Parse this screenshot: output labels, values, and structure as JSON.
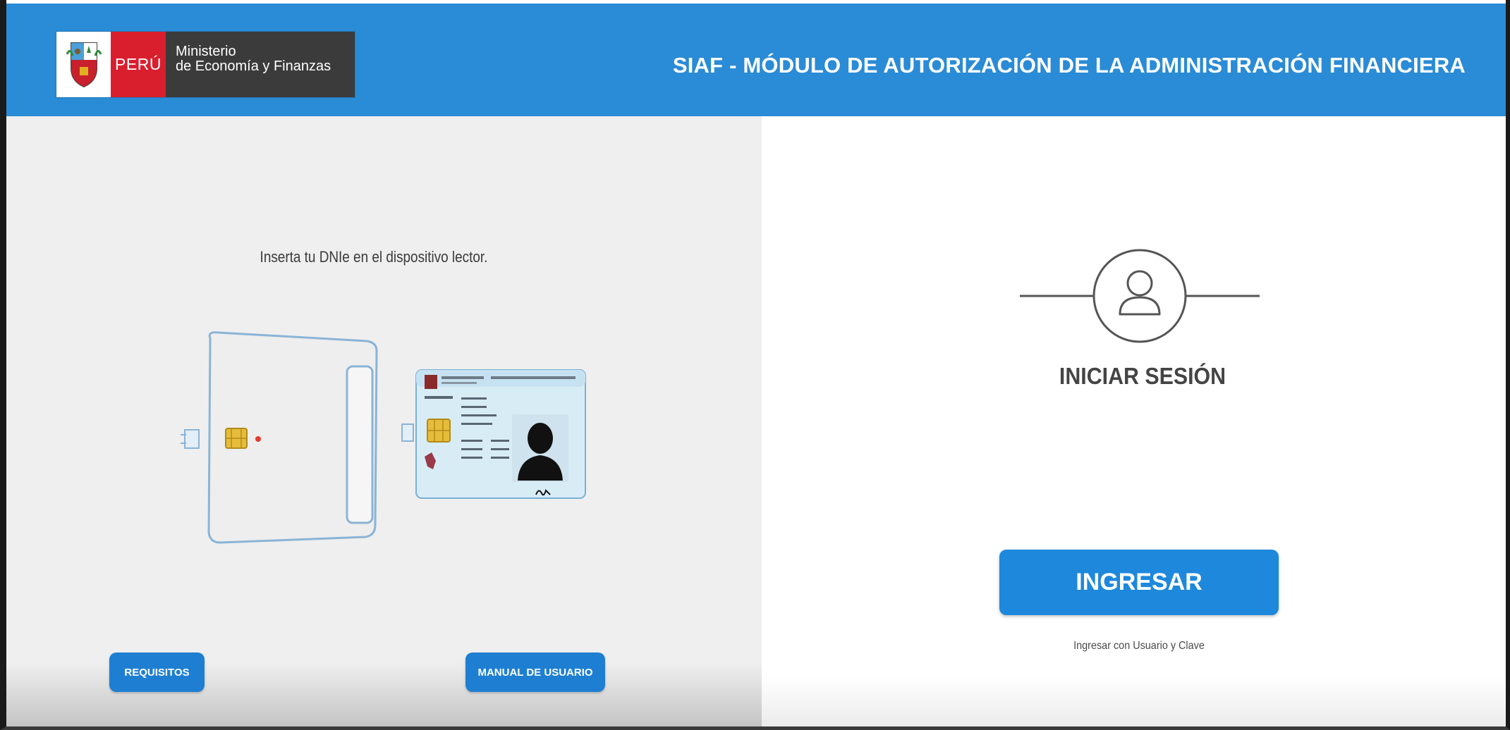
{
  "header": {
    "logo": {
      "country": "PERÚ",
      "ministry_line1": "Ministerio",
      "ministry_line2": "de Economía y Finanzas"
    },
    "title": "SIAF - MÓDULO DE AUTORIZACIÓN DE LA ADMINISTRACIÓN FINANCIERA"
  },
  "left": {
    "instruction": "Inserta tu DNIe en el dispositivo lector.",
    "illustration_icons": [
      "card-reader-icon",
      "dnie-card-icon"
    ],
    "buttons": {
      "requisitos": "REQUISITOS",
      "manual": "MANUAL DE USUARIO"
    }
  },
  "right": {
    "user_icon": "user-icon",
    "title": "INICIAR SESIÓN",
    "login_button": "INGRESAR",
    "alt_login_link": "Ingresar con Usuario y Clave"
  },
  "colors": {
    "header_blue": "#2a8bd6",
    "button_blue": "#1e88dc",
    "peru_red": "#d91e2e",
    "ministry_gray": "#3b3b3b",
    "left_panel_bg": "#efefef"
  }
}
